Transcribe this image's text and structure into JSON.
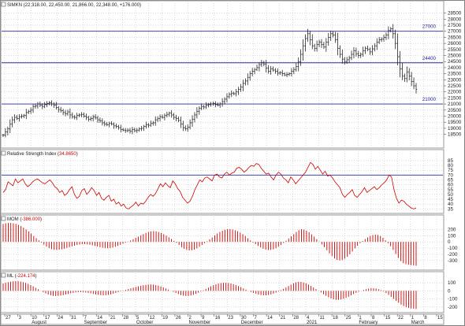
{
  "chart_data": {
    "type": "stock-indicator-panels",
    "colors": {
      "price": "#1a1a1a",
      "indicator": "#cc0000",
      "hline": "#2a2aa0",
      "grid": "#b8b8b8"
    },
    "price": {
      "header": "SIMKN (22,318.00, 22,450.00, 21,866.00, 22,348.00, +176.000)",
      "ylim": [
        17500,
        28800
      ],
      "yticks": [
        "28500",
        "28000",
        "27500",
        "27000",
        "26500",
        "26000",
        "25500",
        "25000",
        "24500",
        "24000",
        "23500",
        "23000",
        "22500",
        "22000",
        "21500",
        "21000",
        "20500",
        "20000",
        "19500",
        "19000",
        "18500"
      ],
      "hlines": [
        {
          "value": 27000,
          "label": "27000"
        },
        {
          "value": 24400,
          "label": "24400"
        },
        {
          "value": 21000,
          "label": "21000"
        }
      ],
      "closes": [
        18450,
        18700,
        18950,
        19350,
        19700,
        19900,
        19800,
        19950,
        20000,
        20050,
        20300,
        20400,
        20500,
        20800,
        20850,
        21000,
        20900,
        20800,
        20950,
        21050,
        21100,
        21000,
        20900,
        20700,
        20550,
        20450,
        20300,
        20200,
        20350,
        20100,
        19950,
        19900,
        20050,
        20100,
        20150,
        20000,
        19900,
        19750,
        19800,
        19950,
        19850,
        19700,
        19600,
        19450,
        19350,
        19300,
        19400,
        19350,
        19200,
        19150,
        19050,
        18900,
        18850,
        18800,
        18850,
        18750,
        18900,
        18800,
        18850,
        18950,
        19000,
        19150,
        19300,
        19250,
        19400,
        19450,
        19700,
        19800,
        19950,
        19900,
        20050,
        20150,
        20250,
        20100,
        19900,
        19800,
        19650,
        19350,
        19050,
        18950,
        19100,
        19450,
        19750,
        20100,
        20400,
        20650,
        20800,
        20750,
        20900,
        20950,
        21000,
        21050,
        20950,
        20900,
        21000,
        21200,
        21400,
        21600,
        21800,
        21900,
        21850,
        22000,
        22200,
        22400,
        22700,
        22900,
        23200,
        23500,
        23700,
        23850,
        24000,
        24250,
        24400,
        24300,
        23950,
        23700,
        23900,
        23800,
        23700,
        23550,
        23600,
        23500,
        23400,
        23450,
        23500,
        23700,
        23850,
        24100,
        24500,
        25100,
        25800,
        26400,
        26800,
        26300,
        25800,
        25600,
        25900,
        26100,
        25900,
        25700,
        26100,
        26500,
        26800,
        26700,
        26300,
        25600,
        25100,
        24700,
        24500,
        24650,
        24800,
        25100,
        25400,
        25150,
        25000,
        25100,
        25400,
        25600,
        25500,
        25300,
        25550,
        25800,
        26100,
        26300,
        26350,
        26500,
        26700,
        27050,
        27200,
        26800,
        26000,
        24900,
        23900,
        23300,
        23100,
        23650,
        23300,
        22850,
        22500,
        22200
      ]
    },
    "rsi": {
      "header": "Relative Strength Index",
      "value_label": "34.8650",
      "ylim": [
        32,
        89
      ],
      "yticks": [
        "85",
        "80",
        "75",
        "70",
        "65",
        "60",
        "55",
        "50",
        "45",
        "40",
        "35"
      ],
      "hline": 70,
      "values": [
        52,
        55,
        63,
        61,
        59,
        66,
        62,
        64,
        66,
        61,
        58,
        60,
        63,
        65,
        66,
        64,
        62,
        61,
        63,
        65,
        62,
        58,
        56,
        52,
        54,
        49,
        51,
        55,
        58,
        50,
        46,
        48,
        54,
        56,
        50,
        53,
        57,
        54,
        49,
        52,
        46,
        44,
        47,
        49,
        43,
        45,
        40,
        42,
        38,
        40,
        36,
        35,
        37,
        39,
        42,
        38,
        41,
        40,
        43,
        47,
        50,
        48,
        51,
        56,
        61,
        58,
        62,
        59,
        57,
        64,
        61,
        56,
        53,
        47,
        44,
        41,
        43,
        48,
        55,
        60,
        65,
        63,
        67,
        68,
        66,
        64,
        70,
        71,
        68,
        67,
        71,
        73,
        70,
        72,
        73,
        77,
        78,
        76,
        73,
        75,
        78,
        80,
        79,
        82,
        81,
        77,
        74,
        71,
        72,
        68,
        65,
        70,
        73,
        71,
        67,
        65,
        62,
        68,
        65,
        61,
        64,
        67,
        70,
        73,
        78,
        83,
        81,
        76,
        79,
        75,
        71,
        74,
        69,
        70,
        67,
        63,
        60,
        57,
        50,
        47,
        50,
        52,
        55,
        49,
        47,
        50,
        53,
        57,
        52,
        54,
        56,
        58,
        55,
        57,
        60,
        62,
        65,
        70,
        68,
        55,
        46,
        41,
        44,
        43,
        40,
        38,
        36,
        35,
        36
      ]
    },
    "mom": {
      "header": "MOM",
      "value_label": "-386.000",
      "ylim": [
        -430,
        320
      ],
      "yticks": [
        "200",
        "100",
        "0",
        "-100",
        "-200",
        "-300"
      ],
      "values": [
        290,
        300,
        305,
        306,
        300,
        290,
        275,
        255,
        230,
        200,
        170,
        135,
        95,
        60,
        25,
        -10,
        -45,
        -75,
        -100,
        -118,
        -128,
        -130,
        -126,
        -120,
        -110,
        -98,
        -85,
        -72,
        -60,
        -50,
        -42,
        -38,
        -36,
        -40,
        -46,
        -55,
        -65,
        -76,
        -86,
        -95,
        -100,
        -102,
        -98,
        -90,
        -78,
        -64,
        -48,
        -30,
        -12,
        6,
        24,
        44,
        65,
        85,
        105,
        125,
        145,
        160,
        170,
        174,
        170,
        160,
        145,
        125,
        100,
        75,
        45,
        15,
        -15,
        -50,
        -85,
        -112,
        -130,
        -138,
        -136,
        -125,
        -105,
        -80,
        -50,
        -20,
        10,
        40,
        72,
        105,
        135,
        160,
        180,
        196,
        205,
        208,
        200,
        188,
        172,
        150,
        125,
        95,
        60,
        25,
        -10,
        -38,
        -65,
        -90,
        -110,
        -125,
        -132,
        -130,
        -120,
        -102,
        -78,
        -50,
        -18,
        18,
        55,
        90,
        125,
        160,
        190,
        205,
        198,
        180,
        155,
        122,
        85,
        45,
        5,
        -40,
        -85,
        -135,
        -185,
        -230,
        -268,
        -290,
        -298,
        -292,
        -270,
        -240,
        -200,
        -155,
        -105,
        -60,
        -20,
        15,
        45,
        72,
        95,
        110,
        118,
        112,
        95,
        65,
        25,
        -20,
        -70,
        -130,
        -195,
        -260,
        -310,
        -345,
        -360,
        -370,
        -375,
        -380,
        -386
      ]
    },
    "ml": {
      "header": "ML",
      "value_label": "-224.174",
      "ylim": [
        -250,
        150
      ],
      "yticks": [
        "100",
        "0",
        "-100",
        "-200"
      ],
      "values": [
        92,
        100,
        108,
        114,
        118,
        120,
        119,
        115,
        108,
        98,
        86,
        72,
        56,
        38,
        20,
        2,
        -16,
        -32,
        -46,
        -56,
        -62,
        -64,
        -62,
        -58,
        -52,
        -45,
        -38,
        -31,
        -25,
        -20,
        -17,
        -16,
        -17,
        -20,
        -25,
        -31,
        -38,
        -44,
        -49,
        -53,
        -55,
        -54,
        -50,
        -43,
        -35,
        -26,
        -16,
        -6,
        4,
        13,
        22,
        31,
        40,
        48,
        56,
        63,
        70,
        75,
        78,
        79,
        77,
        72,
        65,
        55,
        43,
        30,
        16,
        2,
        -12,
        -26,
        -40,
        -52,
        -60,
        -64,
        -63,
        -58,
        -49,
        -37,
        -23,
        -8,
        8,
        24,
        40,
        56,
        70,
        82,
        91,
        97,
        100,
        100,
        97,
        91,
        83,
        72,
        60,
        46,
        31,
        16,
        1,
        -13,
        -26,
        -37,
        -46,
        -52,
        -55,
        -55,
        -51,
        -44,
        -34,
        -22,
        -8,
        8,
        25,
        42,
        60,
        78,
        94,
        106,
        112,
        111,
        104,
        93,
        78,
        61,
        42,
        22,
        1,
        -20,
        -41,
        -61,
        -79,
        -94,
        -105,
        -111,
        -112,
        -107,
        -98,
        -86,
        -72,
        -56,
        -40,
        -25,
        -11,
        1,
        12,
        21,
        28,
        32,
        32,
        28,
        20,
        8,
        -8,
        -27,
        -50,
        -74,
        -99,
        -124,
        -148,
        -170,
        -188,
        -202,
        -212,
        -218,
        -221,
        -224
      ]
    },
    "x_axis": {
      "ticks": [
        "27",
        "3",
        "10",
        "17",
        "24",
        "31",
        "7",
        "14",
        "21",
        "28",
        "5",
        "12",
        "19",
        "26",
        "2",
        "9",
        "16",
        "23",
        "30",
        "7",
        "14",
        "21",
        "28",
        "4",
        "11",
        "18",
        "25",
        "1",
        "8",
        "15",
        "22",
        "1",
        "8",
        "15"
      ],
      "months": [
        "August",
        "September",
        "October",
        "November",
        "December",
        "2021",
        "February",
        "March"
      ]
    }
  }
}
